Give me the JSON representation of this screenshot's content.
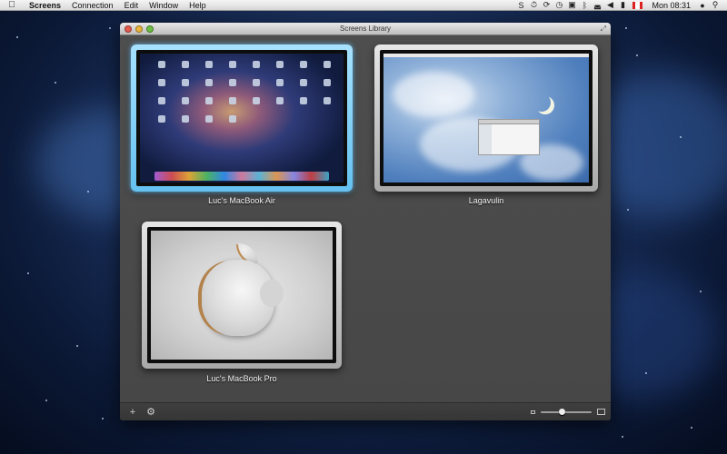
{
  "menubar": {
    "app_name": "Screens",
    "items": [
      "Connection",
      "Edit",
      "Window",
      "Help"
    ],
    "status_icons": [
      "s-icon",
      "history-icon",
      "sync-icon",
      "time-machine-icon",
      "screen-mirror-icon",
      "bluetooth-icon",
      "wifi-icon",
      "volume-icon",
      "battery-icon"
    ],
    "clock": "Mon 08:31"
  },
  "window": {
    "title": "Screens Library",
    "screens": [
      {
        "name": "Luc's MacBook Air",
        "selected": true
      },
      {
        "name": "Lagavulin",
        "selected": false
      },
      {
        "name": "Luc's MacBook Pro",
        "selected": false
      }
    ],
    "bottom_bar": {
      "add_label": "+",
      "settings_label": "⚙",
      "zoom_level": 0.4
    }
  }
}
